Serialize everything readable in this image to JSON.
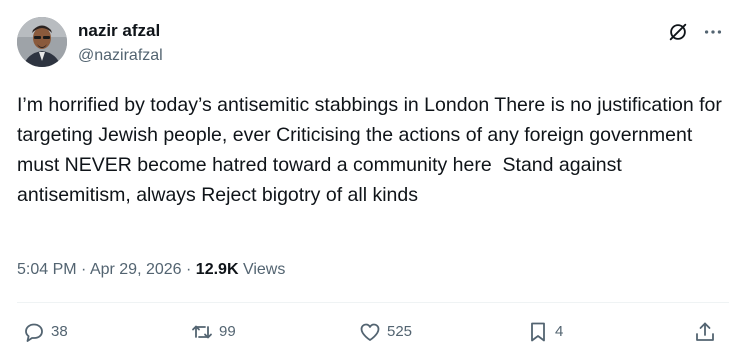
{
  "author": {
    "display_name": "nazir afzal",
    "handle": "@nazirafzal"
  },
  "tweet": {
    "text": "I’m horrified by today’s antisemitic stabbings in London There is no justification for targeting Jewish people, ever Criticising the actions of any foreign government must NEVER become hatred toward a community here  Stand against antisemitism, always Reject bigotry of all kinds"
  },
  "meta": {
    "time": "5:04 PM",
    "separator": "·",
    "date": "Apr 29, 2026",
    "views_count": "12.9K",
    "views_label": "Views"
  },
  "actions": {
    "replies": "38",
    "reposts": "99",
    "likes": "525",
    "bookmarks": "4"
  },
  "icons": {
    "grok": "grok-icon",
    "more": "more-horizontal-icon",
    "reply": "reply-icon",
    "repost": "repost-icon",
    "like": "heart-icon",
    "bookmark": "bookmark-icon",
    "share": "share-icon"
  },
  "colors": {
    "text_primary": "#0f1419",
    "text_secondary": "#536471",
    "divider": "#eff3f4"
  }
}
